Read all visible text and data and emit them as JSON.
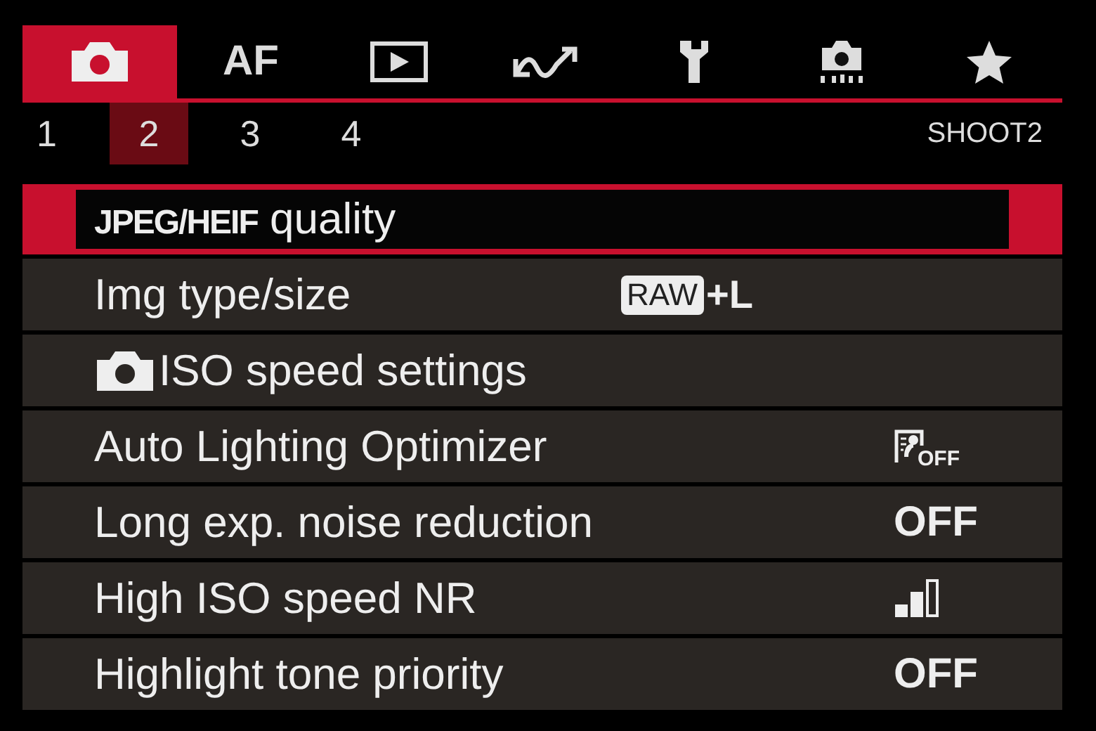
{
  "tabs": [
    {
      "kind": "camera",
      "selected": true
    },
    {
      "kind": "text",
      "label": "AF",
      "selected": false
    },
    {
      "kind": "play",
      "selected": false
    },
    {
      "kind": "wave",
      "selected": false
    },
    {
      "kind": "wrench",
      "selected": false
    },
    {
      "kind": "camera-dots",
      "selected": false
    },
    {
      "kind": "star",
      "selected": false
    }
  ],
  "pages": [
    {
      "label": "1",
      "selected": false
    },
    {
      "label": "2",
      "selected": true
    },
    {
      "label": "3",
      "selected": false
    },
    {
      "label": "4",
      "selected": false
    }
  ],
  "page_title": "SHOOT2",
  "rows": [
    {
      "label": "**JPEG/HEIF** quality",
      "selected": true
    },
    {
      "label": "Img type/size",
      "selected": false,
      "value": {
        "kind": "badge",
        "badge": "RAW",
        "text": "+L"
      }
    },
    {
      "label": "ISO speed settings",
      "selected": false,
      "kind": "camera"
    },
    {
      "label": "Auto Lighting Optimizer",
      "selected": false,
      "value": {
        "kind": "alo",
        "text": "OFF"
      }
    },
    {
      "label": "Long exp. noise reduction",
      "selected": false,
      "value": {
        "kind": "text",
        "text": "OFF"
      }
    },
    {
      "label": "High ISO speed NR",
      "selected": false,
      "value": {
        "kind": "bars",
        "level": 0.67
      }
    },
    {
      "label": "Highlight tone priority",
      "selected": false,
      "value": {
        "kind": "text",
        "text": "OFF"
      }
    }
  ]
}
